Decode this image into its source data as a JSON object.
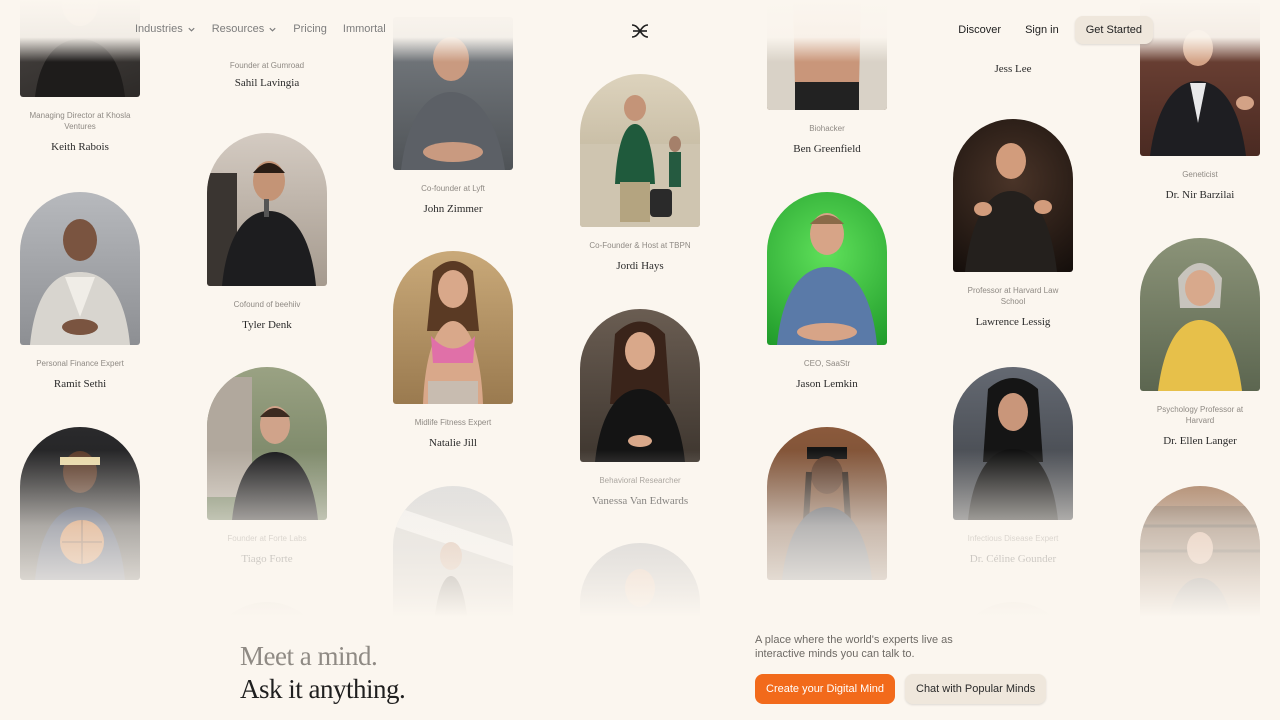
{
  "nav": {
    "industries": "Industries",
    "resources": "Resources",
    "pricing": "Pricing",
    "immortal": "Immortal",
    "discover": "Discover",
    "sign_in": "Sign in",
    "get_started": "Get Started"
  },
  "hero": {
    "line1": "Meet a mind.",
    "line2": "Ask it anything.",
    "tagline": "A place where the world's experts live as interactive minds you can talk to.",
    "primary_cta": "Create your Digital Mind",
    "secondary_cta": "Chat with Popular Minds"
  },
  "colors": {
    "background": "#fbf6ef",
    "accent": "#f26a1b",
    "soft_button": "#efe7dc"
  },
  "minds": [
    {
      "role": "Managing Director at Khosla Ventures",
      "name": "Keith Rabois",
      "bg": "#3a3a3a"
    },
    {
      "role": "Personal Finance Expert",
      "name": "Ramit Sethi",
      "bg": "#a7a8ab"
    },
    {
      "role": "",
      "name": "",
      "bg": "#2a2a2a"
    },
    {
      "role": "Founder at Gumroad",
      "name": "Sahil Lavingia",
      "bg": ""
    },
    {
      "role": "Cofound of beehiiv",
      "name": "Tyler Denk",
      "bg": "#6b6560"
    },
    {
      "role": "Founder at Forte Labs",
      "name": "Tiago Forte",
      "bg": "#7d8a6a"
    },
    {
      "role": "",
      "name": "",
      "bg": "#c9c3bb"
    },
    {
      "role": "",
      "name": "",
      "bg": "#6d7a84"
    },
    {
      "role": "Co-founder at Lyft",
      "name": "John Zimmer",
      "bg": "#5f6468"
    },
    {
      "role": "Midlife Fitness Expert",
      "name": "Natalie Jill",
      "bg": "#b49a74"
    },
    {
      "role": "",
      "name": "",
      "bg": "#b8b8b8"
    },
    {
      "role": "Co-Founder & Host at TBPN",
      "name": "Jordi Hays",
      "bg": "#c7b89b"
    },
    {
      "role": "Behavioral Researcher",
      "name": "Vanessa Van Edwards",
      "bg": "#5a5048"
    },
    {
      "role": "",
      "name": "",
      "bg": "#8d9097"
    },
    {
      "role": "Biohacker",
      "name": "Ben Greenfield",
      "bg": "#8a6a55"
    },
    {
      "role": "CEO, SaaStr",
      "name": "Jason Lemkin",
      "bg": "#2fbf3a"
    },
    {
      "role": "",
      "name": "",
      "bg": "#6c4d3a"
    },
    {
      "role": "",
      "name": "Jess Lee",
      "bg": ""
    },
    {
      "role": "Professor at Harvard Law School",
      "name": "Lawrence Lessig",
      "bg": "#2a1f1a"
    },
    {
      "role": "Infectious Disease Expert",
      "name": "Dr. Céline Gounder",
      "bg": "#4a4a50"
    },
    {
      "role": "",
      "name": "",
      "bg": "#cfc8c0"
    },
    {
      "role": "Geneticist",
      "name": "Dr. Nir Barzilai",
      "bg": "#6e4034"
    },
    {
      "role": "Psychology Professor at Harvard",
      "name": "Dr. Ellen Langer",
      "bg": "#7d8870"
    },
    {
      "role": "",
      "name": "",
      "bg": "#8a5a3a"
    }
  ]
}
